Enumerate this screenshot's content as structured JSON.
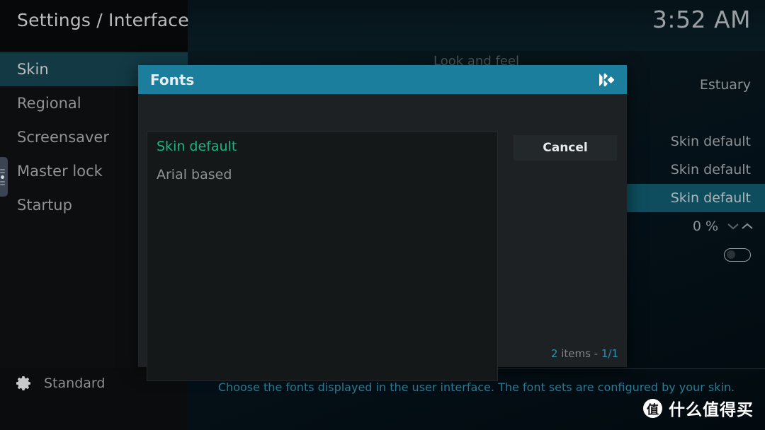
{
  "header": {
    "breadcrumb": "Settings / Interface",
    "clock": "3:52 AM"
  },
  "sidebar": {
    "items": [
      {
        "label": "Skin",
        "active": true
      },
      {
        "label": "Regional",
        "active": false
      },
      {
        "label": "Screensaver",
        "active": false
      },
      {
        "label": "Master lock",
        "active": false
      },
      {
        "label": "Startup",
        "active": false
      }
    ],
    "scroll_handle_icon": "scroll-handle-icon"
  },
  "profile": {
    "icon": "gear-icon",
    "label": "Standard"
  },
  "main": {
    "section_header": "Look and feel",
    "values": [
      {
        "text": "Estuary",
        "selected": false
      },
      {
        "text": "",
        "selected": false
      },
      {
        "text": "Skin default",
        "selected": false
      },
      {
        "text": "Skin default",
        "selected": false
      },
      {
        "text": "Skin default",
        "selected": true
      }
    ],
    "zoom_value": "0 %",
    "spinner_down_icon": "chevron-down-icon",
    "spinner_up_icon": "chevron-up-icon",
    "toggle_state": "off"
  },
  "help": {
    "text": "Choose the fonts displayed in the user interface. The font sets are configured by your skin."
  },
  "dialog": {
    "title": "Fonts",
    "logo_icon": "kodi-logo-icon",
    "items": [
      {
        "label": "Skin default",
        "active": true
      },
      {
        "label": "Arial based",
        "active": false
      }
    ],
    "cancel_label": "Cancel",
    "count_prefix": "2",
    "count_mid": " items - ",
    "count_page": "1/1"
  },
  "watermark": {
    "badge": "值",
    "text": "什么值得买"
  },
  "colors": {
    "accent": "#1b7e9c",
    "selected_row": "#0e4d5e",
    "active_green": "#14b87e",
    "help_text": "#2c7a91"
  }
}
